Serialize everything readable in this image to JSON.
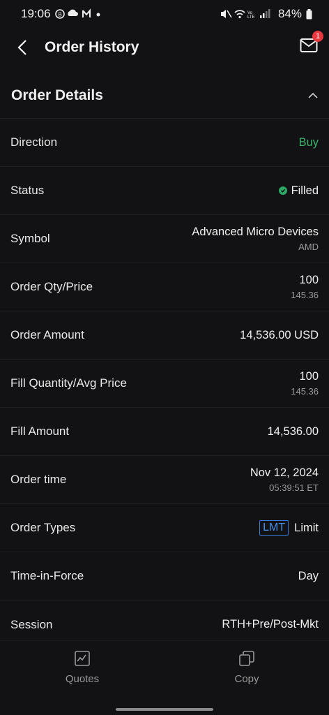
{
  "status_bar": {
    "time": "19:06",
    "battery": "84%"
  },
  "header": {
    "title": "Order History",
    "badge_count": "1"
  },
  "section": {
    "title": "Order Details"
  },
  "rows": {
    "direction": {
      "label": "Direction",
      "value": "Buy"
    },
    "status": {
      "label": "Status",
      "value": "Filled"
    },
    "symbol": {
      "label": "Symbol",
      "value": "Advanced Micro Devices",
      "sub": "AMD"
    },
    "order_qty": {
      "label": "Order Qty/Price",
      "value": "100",
      "sub": "145.36"
    },
    "order_amount": {
      "label": "Order Amount",
      "value": "14,536.00 USD"
    },
    "fill_qty": {
      "label": "Fill Quantity/Avg Price",
      "value": "100",
      "sub": "145.36"
    },
    "fill_amount": {
      "label": "Fill Amount",
      "value": "14,536.00"
    },
    "order_time": {
      "label": "Order time",
      "value": "Nov 12, 2024",
      "sub": "05:39:51 ET"
    },
    "order_types": {
      "label": "Order Types",
      "tag": "LMT",
      "value": "Limit"
    },
    "tif": {
      "label": "Time-in-Force",
      "value": "Day"
    },
    "session": {
      "label": "Session",
      "value": "RTH+Pre/Post-Mkt"
    }
  },
  "bottom_nav": {
    "quotes": "Quotes",
    "copy": "Copy"
  },
  "colors": {
    "background": "#121214",
    "buy_green": "#3bb36a",
    "badge_red": "#e5383f",
    "lmt_blue": "#4a90e8"
  },
  "icons": [
    "back-arrow-icon",
    "mail-icon",
    "chevron-up-icon",
    "check-circle-icon",
    "chart-icon",
    "copy-icon"
  ]
}
